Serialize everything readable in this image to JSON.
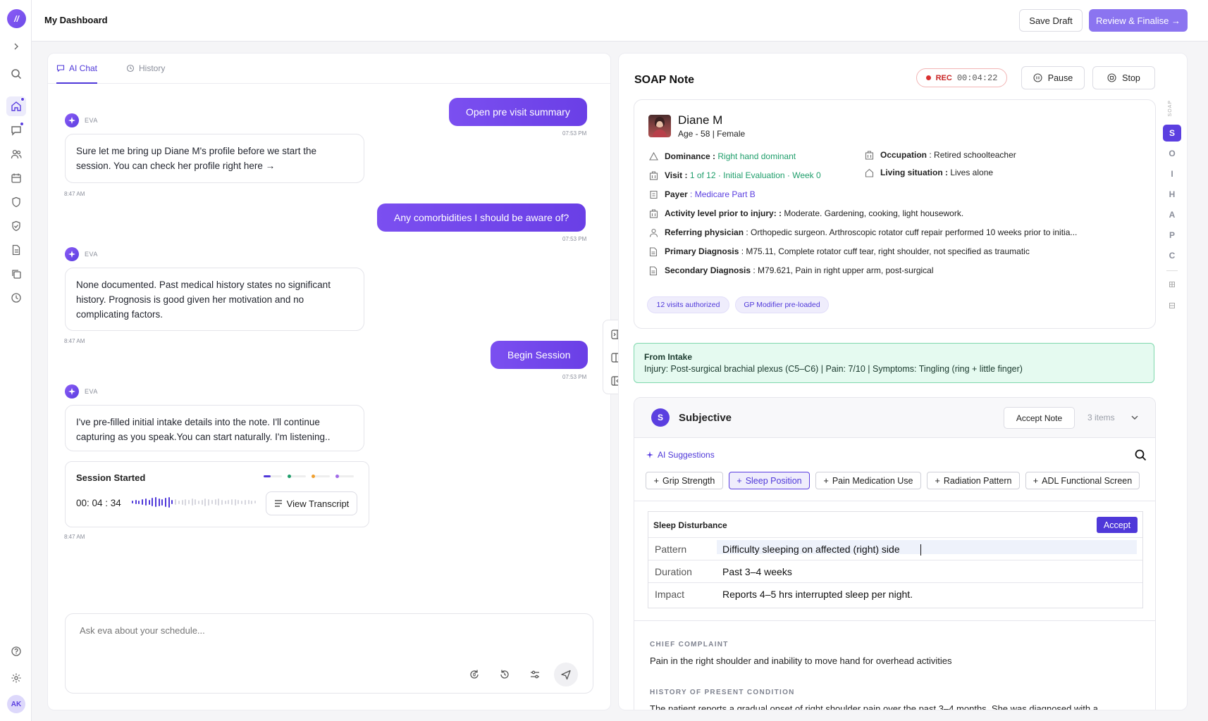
{
  "app": {
    "title": "My Dashboard"
  },
  "header": {
    "save_draft": "Save Draft",
    "review_finalise": "Review & Finalise →"
  },
  "sidebar": {
    "logo": "//",
    "icons": [
      "chevron-right-icon",
      "search-icon",
      "home-icon",
      "chat-icon",
      "users-icon",
      "calendar-icon",
      "shield-icon",
      "shield-check-icon",
      "document-icon",
      "copy-icon",
      "clock-icon",
      "help-icon",
      "settings-icon"
    ],
    "avatar": "AK"
  },
  "chat": {
    "tabs": [
      {
        "label": "AI Chat"
      },
      {
        "label": "History"
      }
    ],
    "assistant_name": "EVA",
    "messages": [
      {
        "role": "user",
        "text": "Open pre visit summary",
        "time": "07:53 PM"
      },
      {
        "role": "ai",
        "text": "Sure let me bring up Diane M's profile before we start the session. You can check her profile right here →",
        "time": "8:47 AM"
      },
      {
        "role": "user",
        "text": "Any comorbidities I should be aware of?",
        "time": "07:53 PM"
      },
      {
        "role": "ai",
        "text": "None documented. Past medical history states no significant history. Prognosis is good given her motivation and no complicating factors.",
        "time": "8:47 AM"
      },
      {
        "role": "user",
        "text": "Begin Session",
        "time": "07:53 PM"
      },
      {
        "role": "ai",
        "text": "I've pre-filled initial intake details into the note. I'll continue capturing as you speak.You can start naturally. I'm listening..",
        "time": ""
      }
    ],
    "session": {
      "title": "Session Started",
      "timer": "00: 04 : 34",
      "transcript_button": "View Transcript",
      "time": "8:47 AM"
    },
    "composer": {
      "placeholder": "Ask eva about your schedule..."
    }
  },
  "soap": {
    "title": "SOAP Note",
    "rec": {
      "label": "REC",
      "time": "00:04:22"
    },
    "pause": "Pause",
    "stop": "Stop",
    "patient": {
      "name": "Diane M",
      "age_gender": "Age - 58 | Female",
      "dominance_label": "Dominance :",
      "dominance": "Right hand dominant",
      "visit_label": "Visit :",
      "visit": "1 of 12 · Initial Evaluation · Week 0",
      "payer_label": "Payer",
      "payer": ": Medicare Part B",
      "activity_label": "Activity level prior to injury: :",
      "activity": " Moderate. Gardening, cooking, light housework.",
      "referring_label": "Referring physician",
      "referring": ": Orthopedic surgeon. Arthroscopic rotator cuff repair performed 10 weeks prior to initia...",
      "primary_label": "Primary Diagnosis",
      "primary": ": M75.11, Complete rotator cuff tear, right shoulder, not specified as traumatic",
      "secondary_label": "Secondary Diagnosis",
      "secondary": ": M79.621, Pain in right upper arm, post-surgical",
      "occupation_label": "Occupation",
      "occupation": ": Retired schoolteacher",
      "living_label": "Living situation :",
      "living": " Lives alone",
      "chips": [
        "12 visits authorized",
        "GP Modifier pre-loaded"
      ]
    },
    "intake": {
      "title": "From Intake",
      "text": "Injury: Post-surgical brachial plexus (C5–C6) | Pain: 7/10  | Symptoms: Tingling (ring + little finger)"
    },
    "subjective": {
      "badge": "S",
      "title": "Subjective",
      "accept_note": "Accept Note",
      "count": "3 items",
      "ai_label": "AI Suggestions",
      "suggestions": [
        "Grip Strength",
        "Sleep Position",
        "Pain Medication Use",
        "Radiation Pattern",
        "ADL Functional Screen"
      ],
      "detail": {
        "title": "Sleep Disturbance",
        "accept": "Accept",
        "rows": [
          {
            "k": "Pattern",
            "v": "Difficulty sleeping on affected (right) side"
          },
          {
            "k": "Duration",
            "v": "Past 3–4 weeks"
          },
          {
            "k": "Impact",
            "v": "Reports 4–5 hrs interrupted sleep per night."
          }
        ]
      },
      "chief_label": "CHIEF COMPLAINT",
      "chief": "Pain in the right shoulder and inability to move hand for overhead activities",
      "hpc_label": "HISTORY OF PRESENT CONDITION",
      "hpc": "The patient reports a gradual onset of right shoulder pain over the past 3–4 months. She was diagnosed with a"
    },
    "nav": {
      "vertical_label": "SOAP",
      "letters": [
        "S",
        "O",
        "I",
        "H",
        "A",
        "P",
        "C"
      ]
    }
  },
  "colors": {
    "accent": "#5b3fe0",
    "rec": "#d93030",
    "intake_bg": "#e5faf0",
    "green_text": "#1f9e6b"
  }
}
